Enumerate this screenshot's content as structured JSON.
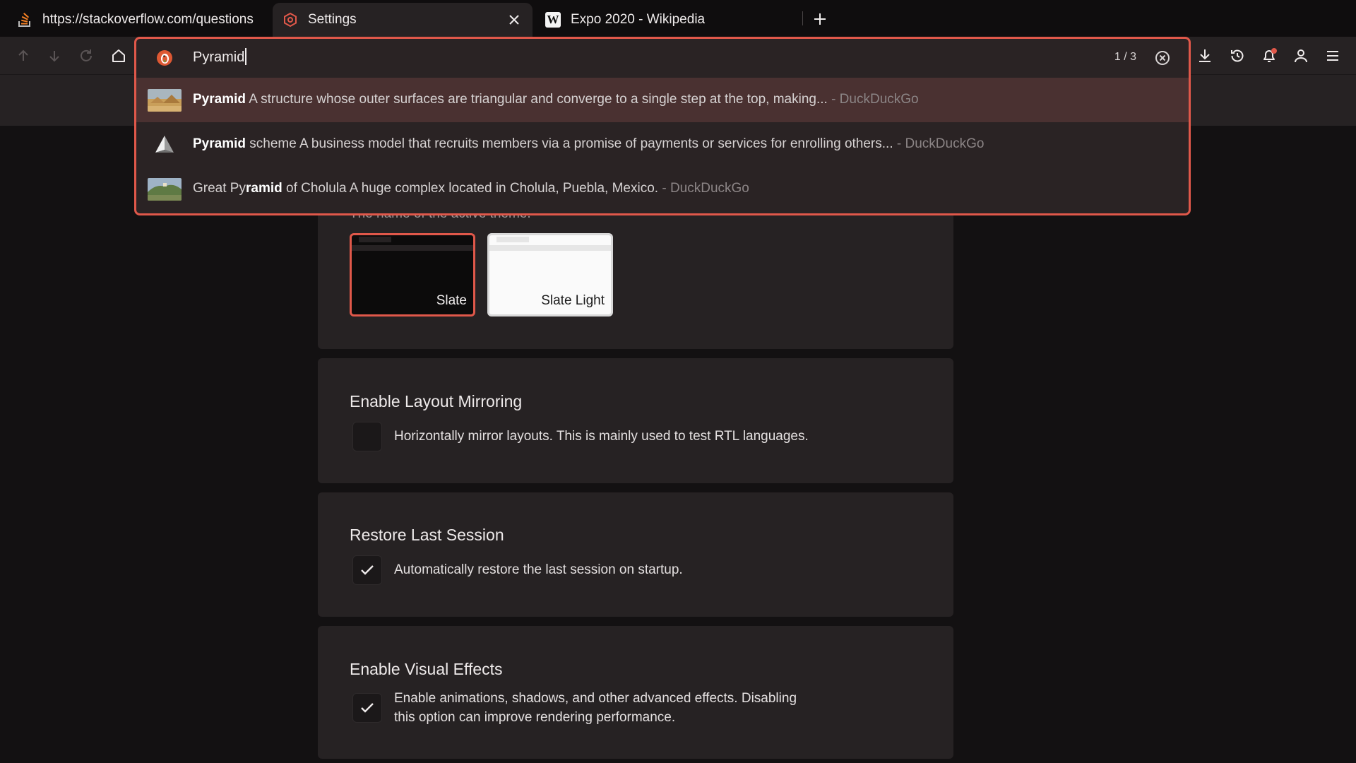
{
  "tabs": [
    {
      "title": "https://stackoverflow.com/questions",
      "favicon": "stackoverflow-icon"
    },
    {
      "title": "Settings",
      "favicon": "settings-hexagon-icon",
      "active": true
    },
    {
      "title": "Expo 2020 - Wikipedia",
      "favicon": "wikipedia-icon",
      "favicon_text": "W"
    }
  ],
  "omnibox": {
    "value": "Pyramid",
    "count": "1 / 3",
    "engine_icon": "duckduckgo-icon",
    "suggestions": [
      {
        "match": "Pyramid",
        "pre": "",
        "post_match": "",
        "rest": " A structure whose outer surfaces are triangular and converge to a single step at the top, making...",
        "source": " - DuckDuckGo",
        "selected": true
      },
      {
        "pre": "",
        "match": "Pyramid",
        "rest": " scheme A business model that recruits members via a promise of payments or services for enrolling others...",
        "source": " - DuckDuckGo"
      },
      {
        "pre": "Great Py",
        "match": "ramid",
        "rest": " of Cholula A huge complex located in Cholula, Puebla, Mexico.",
        "source": " - DuckDuckGo"
      }
    ]
  },
  "settings": {
    "theme": {
      "description": "The name of the active theme.",
      "options": [
        "Slate",
        "Slate Light"
      ],
      "selected": "Slate"
    },
    "layout_mirroring": {
      "title": "Enable Layout Mirroring",
      "label": "Horizontally mirror layouts. This is mainly used to test RTL languages.",
      "checked": false
    },
    "restore_session": {
      "title": "Restore Last Session",
      "label": "Automatically restore the last session on startup.",
      "checked": true
    },
    "visual_effects": {
      "title": "Enable Visual Effects",
      "label_line1": "Enable animations, shadows, and other advanced effects. Disabling",
      "label_line2": "this option can improve rendering performance.",
      "checked": true
    }
  },
  "colors": {
    "accent": "#e0584a",
    "background": "#131112",
    "surface": "#262223",
    "notification_dot": "#e0584a"
  }
}
